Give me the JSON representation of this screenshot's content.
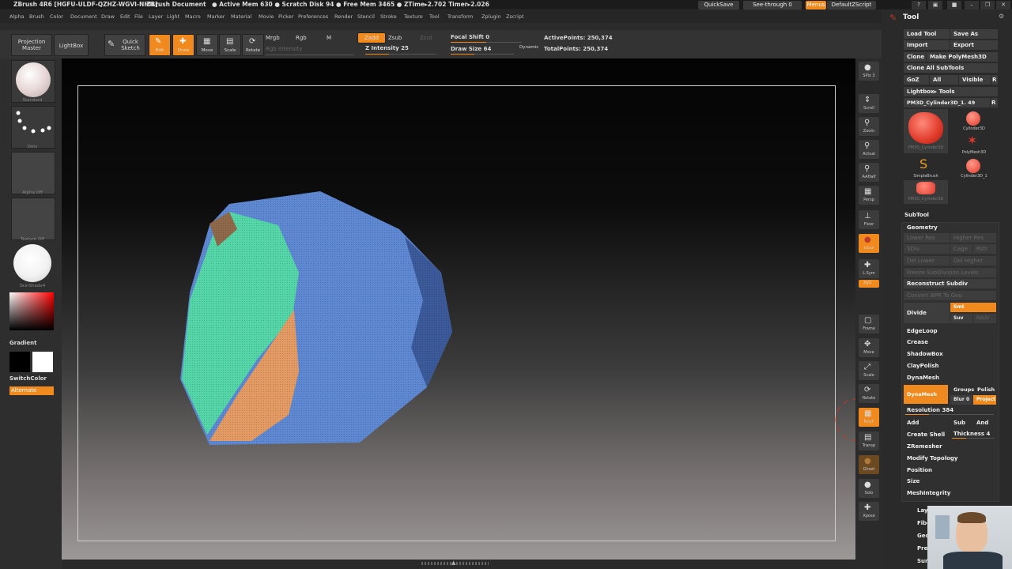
{
  "titlebar": {
    "app": "ZBrush 4R6 [HGFU-ULDF-QZHZ-WGVI-NHIL]",
    "doc": "ZBrush Document",
    "stats": "● Active Mem 630 ● Scratch Disk 94 ● Free Mem 3465 ● ZTime▸2.702 Timer▸2.026",
    "quicksave": "QuickSave",
    "seethrough": "See-through  0",
    "menus": "Menus",
    "script": "DefaultZScript"
  },
  "menubar": [
    "Alpha",
    "Brush",
    "Color",
    "Document",
    "Draw",
    "Edit",
    "File",
    "Layer",
    "Light",
    "Macro",
    "Marker",
    "Material",
    "Movie",
    "Picker",
    "Preferences",
    "Render",
    "Stencil",
    "Stroke",
    "Texture",
    "Tool",
    "Transform",
    "Zplugin",
    "Zscript"
  ],
  "toolbar": {
    "projection_master": "Projection Master",
    "lightbox": "LightBox",
    "quick_sketch": "Quick Sketch",
    "edit": "Edit",
    "draw": "Draw",
    "move": "Move",
    "scale": "Scale",
    "rotate": "Rotate",
    "mrgb": "Mrgb",
    "rgb": "Rgb",
    "m": "M",
    "rgb_intensity": "Rgb Intensity",
    "zadd": "Zadd",
    "zsub": "Zsub",
    "zcut": "Zcut",
    "z_intensity": "Z Intensity 25",
    "focal_shift": "Focal Shift 0",
    "draw_size": "Draw Size 64",
    "dynamic": "Dynamic",
    "active_points": "ActivePoints: 250,374",
    "total_points": "TotalPoints: 250,374"
  },
  "leftshelf": {
    "standard": "Standard",
    "dots": "Dots",
    "alpha_off": "Alpha  Off",
    "texture_off": "Texture  Off",
    "skinshade": "SkinShade4",
    "gradient": "Gradient",
    "switchcolor": "SwitchColor",
    "alternate": "Alternate"
  },
  "rightshelf": [
    {
      "icon": "●",
      "label": "SPix 3"
    },
    {
      "icon": "⇕",
      "label": "Scroll"
    },
    {
      "icon": "⚲",
      "label": "Zoom"
    },
    {
      "icon": "⚲",
      "label": "Actual"
    },
    {
      "icon": "⚲",
      "label": "AAHalf"
    },
    {
      "icon": "▦",
      "label": "Persp"
    },
    {
      "icon": "⊥",
      "label": "Floor"
    },
    {
      "icon": "●",
      "label": "Local"
    },
    {
      "icon": "✚",
      "label": "L.Sym"
    },
    {
      "icon": "xyz",
      "label": "Gxyz"
    },
    {
      "icon": "▢",
      "label": "Frame"
    },
    {
      "icon": "✥",
      "label": "Move"
    },
    {
      "icon": "⤢",
      "label": "Scale"
    },
    {
      "icon": "⟳",
      "label": "Rotate"
    },
    {
      "icon": "▦",
      "label": "PolyF"
    },
    {
      "icon": "▤",
      "label": "Transp"
    },
    {
      "icon": "●",
      "label": "Ghost"
    },
    {
      "icon": "●",
      "label": "Solo"
    },
    {
      "icon": "✚",
      "label": "Xpose"
    }
  ],
  "panel": {
    "title": "Tool",
    "load_tool": "Load Tool",
    "save_as": "Save As",
    "import": "Import",
    "export": "Export",
    "clone": "Clone",
    "make_polymesh": "Make PolyMesh3D",
    "clone_all": "Clone All SubTools",
    "goz": "GoZ",
    "all": "All",
    "visible": "Visible",
    "r": "R",
    "lightbox_tools": "Lightbox▸ Tools",
    "current_tool": "PM3D_Cylinder3D_1. 49",
    "thumbs": [
      "PM3D_Cylinder3D",
      "Cylinder3D",
      "PolyMesh3D",
      "SimpleBrush",
      "Cylinder3D_1",
      "PM3D_Cylinder3D"
    ],
    "subtool": "SubTool",
    "geometry": "Geometry",
    "lower_res": "Lower Res",
    "higher_res": "Higher Res",
    "sdiv": "SDiv",
    "cage": "Cage",
    "rstr": "Rstr",
    "del_lower": "Del Lower",
    "del_higher": "Del Higher",
    "freeze": "Freeze SubDivision Levels",
    "reconstruct": "Reconstruct Subdiv",
    "convert_bpr": "Convert BPR To Geo",
    "divide": "Divide",
    "smt": "Smt",
    "suv": "Suv",
    "reuv": "ReUV",
    "edgeloop": "EdgeLoop",
    "crease": "Crease",
    "shadowbox": "ShadowBox",
    "claypolish": "ClayPolish",
    "dynamesh": "DynaMesh",
    "dynamesh_btn": "DynaMesh",
    "groups": "Groups",
    "polish": "Polish",
    "blur": "Blur 0",
    "project": "Project",
    "resolution": "Resolution 384",
    "add": "Add",
    "sub": "Sub",
    "and": "And",
    "create_shell": "Create Shell",
    "thickness": "Thickness 4",
    "zremesher": "ZRemesher",
    "modify_topology": "Modify Topology",
    "position": "Position",
    "size": "Size",
    "meshintegrity": "MeshIntegrity",
    "layers": "Layers",
    "fibermesh": "FiberMesh",
    "geometry_hd": "Geometry HD",
    "preview": "Preview",
    "surface": "Surface"
  },
  "colors": {
    "accent": "#f08a1e",
    "background": "#2b2b2b",
    "mesh_blue": "#5e89d2",
    "mesh_green": "#54d6a8",
    "mesh_orange": "#e39a63"
  }
}
